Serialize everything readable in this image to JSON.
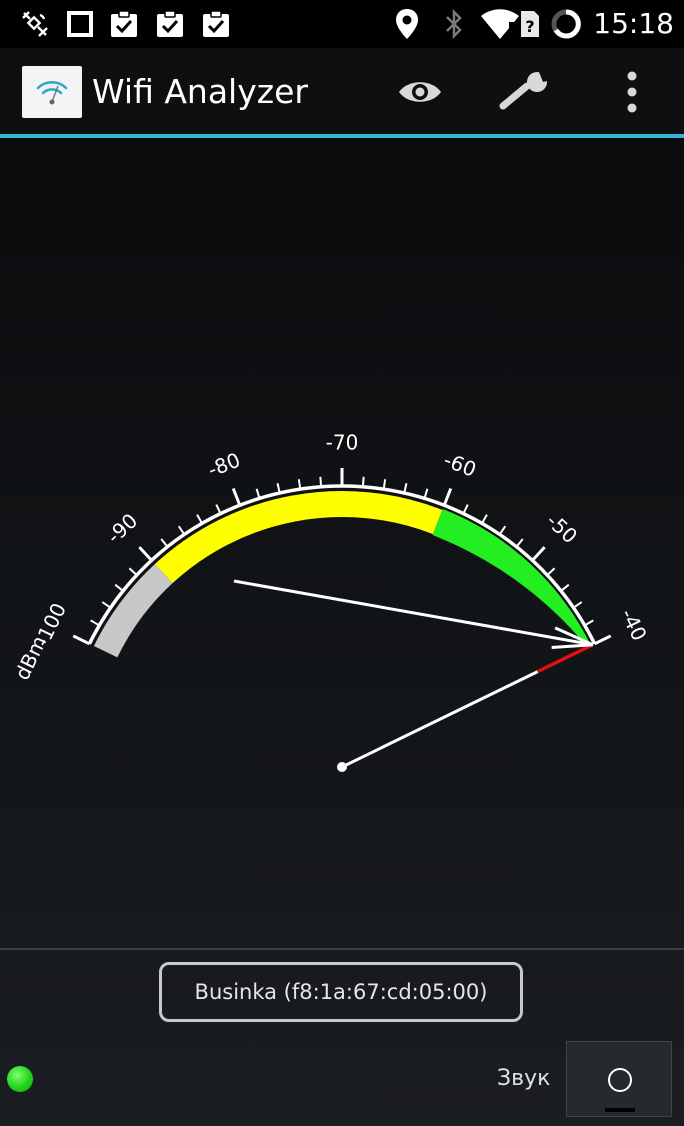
{
  "status_bar": {
    "time": "15:18",
    "left_icons": [
      "satellite-icon",
      "square-icon",
      "clipboard-check-icon",
      "clipboard-check-icon",
      "clipboard-check-icon"
    ],
    "right_icons": [
      "location-pin-icon",
      "bluetooth-icon",
      "wifi-icon",
      "sim-card-question-icon",
      "battery-ring-icon"
    ]
  },
  "action_bar": {
    "title": "Wifi Analyzer",
    "actions": [
      "eye-icon",
      "wrench-icon",
      "overflow-menu-icon"
    ]
  },
  "meter": {
    "unit": "dBm",
    "scale_min": -100,
    "scale_max": -40,
    "major_ticks": [
      "-100",
      "-90",
      "-80",
      "-70",
      "-60",
      "-50",
      "-40"
    ],
    "color_bands": [
      {
        "from": -100,
        "to": -90,
        "color": "#c8c8c8"
      },
      {
        "from": -90,
        "to": -60,
        "color": "#ffff00"
      },
      {
        "from": -60,
        "to": -40,
        "color": "#22ee22"
      }
    ],
    "needle_color": "#ffffff",
    "needle_tip_color": "#dd1111",
    "arc_color": "#ffffff"
  },
  "access_point": {
    "label": "Businka (f8:1a:67:cd:05:00)"
  },
  "footer": {
    "status_color": "#22d21b",
    "sound_label": "Звук",
    "sound_toggle_on": false
  }
}
